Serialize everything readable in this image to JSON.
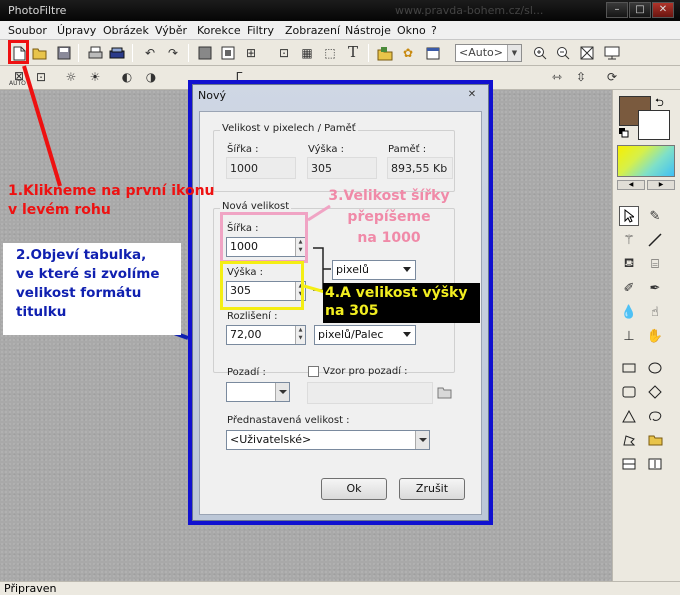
{
  "window": {
    "title": "PhotoFiltre",
    "ghost_url": "www.pravda-bohem.cz/sl...",
    "min": "–",
    "max": "□",
    "close": "✕"
  },
  "menu": [
    "Soubor",
    "Úpravy",
    "Obrázek",
    "Výběr",
    "Korekce",
    "Filtry",
    "Zobrazení",
    "Nástroje",
    "Okno",
    "?"
  ],
  "toolbar": {
    "zoom_value": "<Auto>",
    "auto_label": "AUTO"
  },
  "dialog": {
    "title": "Nový",
    "close": "✕",
    "size_section": "Velikost v pixelech / Paměť",
    "width_label": "Šířka :",
    "width_value": "1000",
    "height_label": "Výška :",
    "height_value": "305",
    "memory_label": "Paměť :",
    "memory_value": "893,55 Kb",
    "new_size_section": "Nová velikost",
    "new_width_label": "Šířka :",
    "new_width_value": "1000",
    "new_height_label": "Výška :",
    "new_height_value": "305",
    "unit_value": "pixelů",
    "resolution_label": "Rozlišení :",
    "resolution_value": "72,00",
    "resolution_unit": "pixelů/Palec",
    "background_label": "Pozadí :",
    "pattern_label": "Vzor pro pozadí :",
    "preset_label": "Přednastavená velikost :",
    "preset_value": "<Uživatelské>",
    "ok_label": "Ok",
    "cancel_label": "Zrušit"
  },
  "status": {
    "text": "Připraven"
  },
  "annotations": {
    "step1": "1.Klikneme na první ikonu\nv levém rohu",
    "step2": "2.Objeví tabulka,\nve které si zvolíme\nvelikost formátu\ntitulku",
    "step3": "3.Velikost šířky\npřepíšeme\nna 1000",
    "step4": "4.A velikost výšky\nna 305"
  },
  "colors": {
    "foreground": "#7a5a3e",
    "background": "#ffffff",
    "annotation_red": "#ee1111",
    "annotation_blue": "#1020b0",
    "annotation_pink": "#f08aa8",
    "annotation_yellow": "#f2ee20",
    "dialog_frame": "#1010d0"
  },
  "icons": {
    "toolbar1": [
      "new-file-icon",
      "open-folder-icon",
      "save-icon",
      "print-icon",
      "scan-icon",
      "undo-icon",
      "redo-icon",
      "image-size-icon",
      "canvas-size-icon",
      "transform-icon",
      "crop-icon",
      "mask-icon",
      "selection-icon",
      "text-icon",
      "explorer-icon",
      "flower-icon",
      "window-icon",
      "zoom-in-icon",
      "zoom-out-icon",
      "fit-icon",
      "fullscreen-icon"
    ],
    "tools": [
      "selection-arrow-icon",
      "eyedropper-icon",
      "magic-wand-icon",
      "line-icon",
      "fill-bucket-icon",
      "spray-icon",
      "brush-icon",
      "advanced-brush-icon",
      "blur-drop-icon",
      "smudge-icon",
      "stamp-icon",
      "hand-icon",
      "rectangle-icon",
      "ellipse-icon",
      "square-icon",
      "diamond-icon",
      "triangle-icon",
      "lasso-icon",
      "polygon-lasso-icon",
      "folder-icon",
      "grid-icon",
      "bracket-icon"
    ]
  }
}
